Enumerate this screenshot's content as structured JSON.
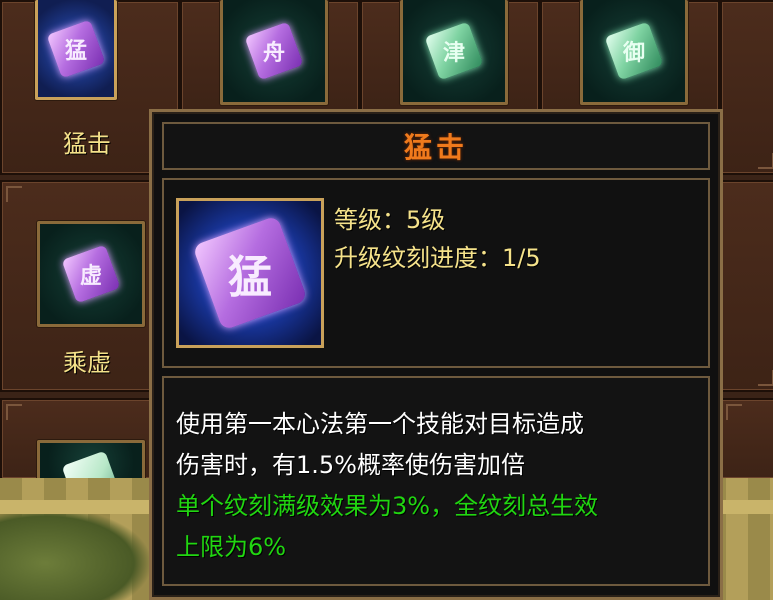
{
  "grid": {
    "skills": [
      {
        "name": "猛击",
        "glyph": "猛"
      },
      {
        "name": "乘虚",
        "glyph": "虚"
      }
    ],
    "top_row_glyphs": [
      "猛",
      "舟",
      "津",
      "御"
    ],
    "partial_glyph": ""
  },
  "tooltip": {
    "title": "猛击",
    "icon_glyph": "猛",
    "level_text": "等级：5级",
    "progress_text": "升级纹刻进度：1/5",
    "description": "使用第一本心法第一个技能对目标造成伤害时，有1.5%概率使伤害加倍",
    "description_line1": "使用第一本心法第一个技能对目标造成",
    "description_line2": "伤害时，有1.5%概率使伤害加倍",
    "bonus_line1": "单个纹刻满级效果为3%，全纹刻总生效",
    "bonus_line2": "上限为6%"
  },
  "colors": {
    "title": "#f07a1c",
    "info_text": "#f5e28a",
    "description": "#ffffff",
    "bonus": "#21d611",
    "frame_gold": "#c9a15a"
  }
}
